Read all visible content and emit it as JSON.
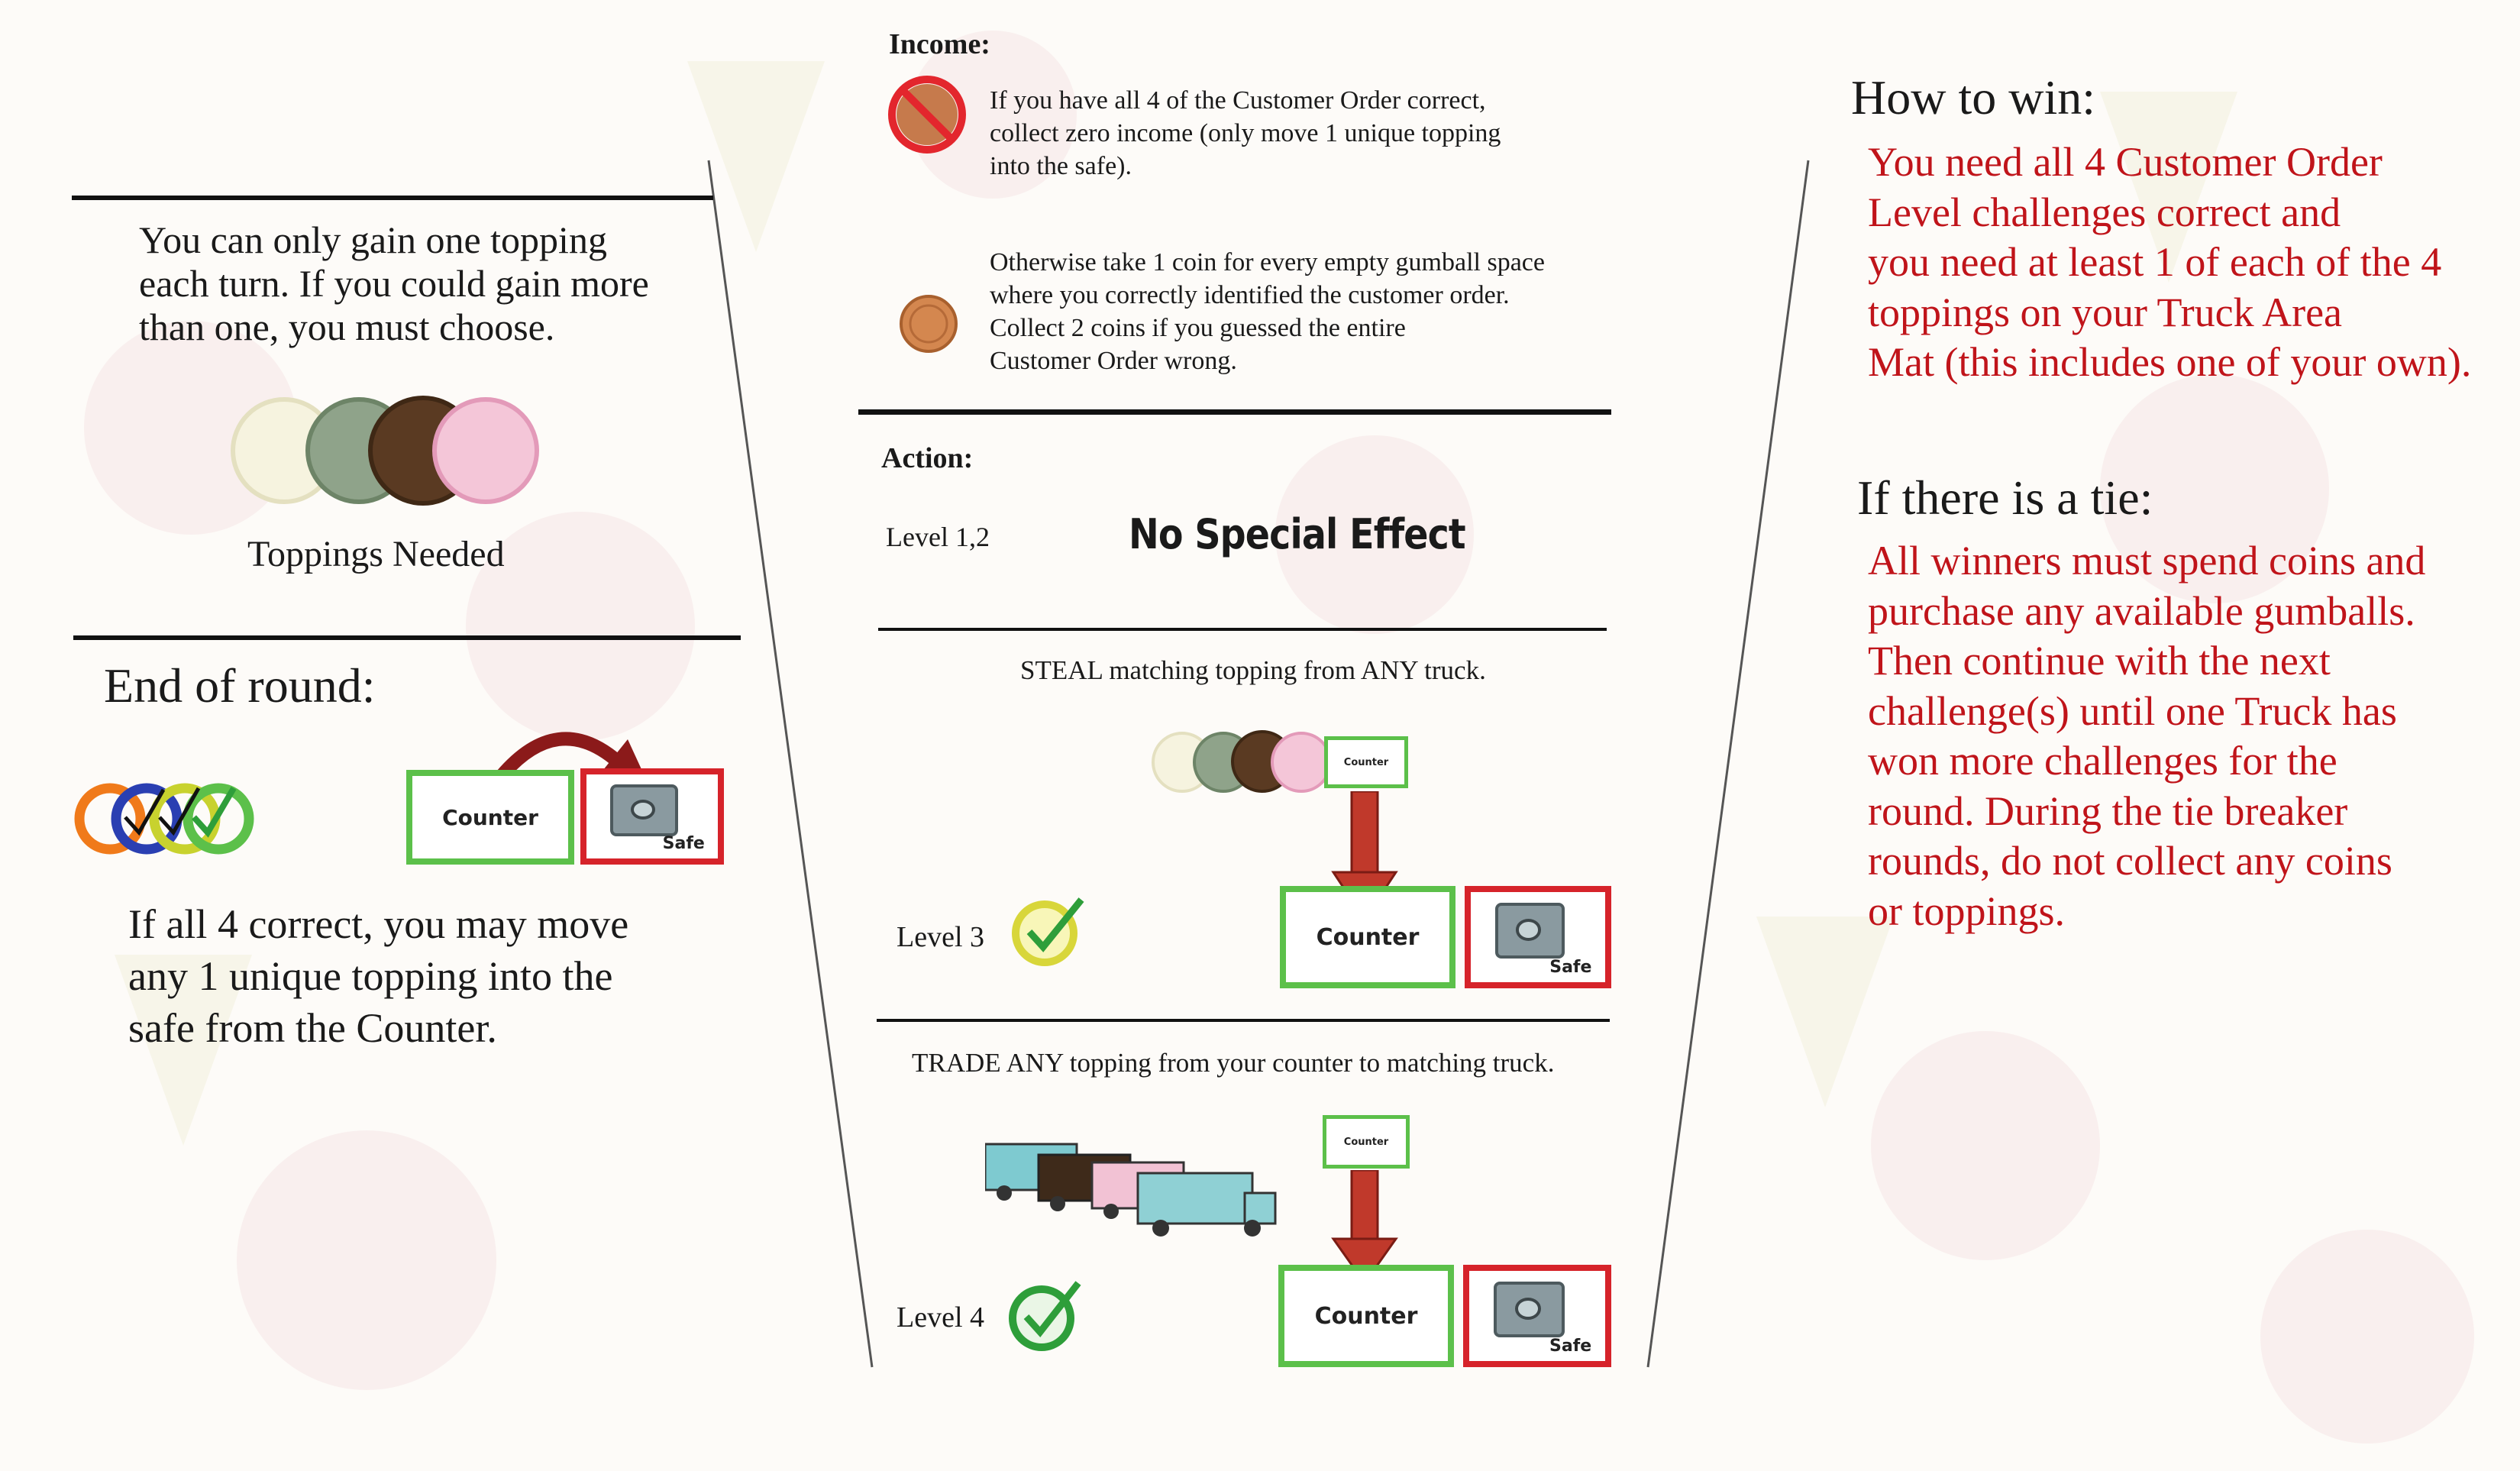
{
  "left": {
    "rule_text": [
      "You can only gain one topping",
      "each turn.  If you could gain more",
      "than one, you must choose."
    ],
    "toppings_caption": "Toppings Needed",
    "end_of_round_heading": "End of round:",
    "counter_label": "Counter",
    "safe_label": "Safe",
    "end_text": [
      "If all 4 correct, you may move",
      "any 1 unique topping into the",
      "safe from the Counter."
    ]
  },
  "middle": {
    "income_heading": "Income:",
    "income_text_1": [
      "If you have all 4 of the Customer Order correct,",
      "collect zero income (only move 1 unique topping",
      "into the safe)."
    ],
    "income_text_2": [
      "Otherwise take 1 coin for every empty gumball space",
      "where you correctly identified the customer order.",
      "Collect 2 coins if you guessed the entire",
      "Customer Order wrong."
    ],
    "action_heading": "Action:",
    "level12_label": "Level 1,2",
    "level12_effect": "No Special Effect",
    "level3_text": "STEAL matching topping from ANY truck.",
    "level3_label": "Level 3",
    "level4_text": "TRADE ANY topping from your counter to matching truck.",
    "level4_label": "Level 4",
    "counter_label": "Counter",
    "safe_label": "Safe"
  },
  "right": {
    "how_to_win_heading": "How to win:",
    "how_to_win_text": [
      "You need all 4 Customer Order",
      "Level challenges correct and",
      "you need at least 1 of each of the 4",
      "toppings on your Truck Area",
      "Mat (this includes one of your own)."
    ],
    "tie_heading": "If there is a tie:",
    "tie_text": [
      "All winners must spend coins and",
      "purchase any available gumballs.",
      "Then continue with the next",
      "challenge(s) until one Truck has",
      "won more challenges for the",
      "round.  During the tie breaker",
      "rounds, do not collect any coins",
      "or toppings."
    ]
  },
  "colors": {
    "red_text": "#c0141a",
    "counter_border": "#5cc04a",
    "safe_border": "#d6232a",
    "arrow_red": "#c0392b",
    "check_green": "#2e9e3a"
  }
}
